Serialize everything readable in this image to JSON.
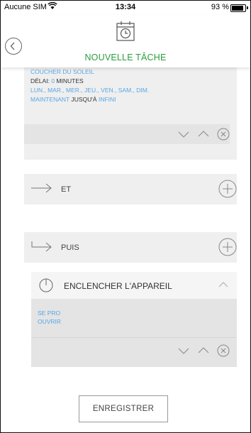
{
  "status_bar": {
    "carrier": "Aucune SIM",
    "time": "13:34",
    "battery": "93 %",
    "battery_level": 0.93
  },
  "header": {
    "title": "NOUVELLE TÂCHE",
    "icon": "calendar-clock-icon"
  },
  "condition": {
    "event": "COUCHER DU SOLEIL",
    "delay_label": "DÉLAI:",
    "delay_value": "0",
    "delay_unit": "MINUTES",
    "days": "LUN., MAR., MER., JEU., VEN., SAM., DIM.",
    "start": "MAINTENANT",
    "until": "JUSQU'À",
    "end": "INFINI"
  },
  "and_row": {
    "label": "ET"
  },
  "then_row": {
    "label": "PUIS"
  },
  "action": {
    "name": "ENCLENCHER L'APPAREIL",
    "option1": "SE PRO",
    "option2": "OUVRIR"
  },
  "save_button": {
    "label": "ENREGISTRER"
  },
  "colors": {
    "accent_green": "#2a9d3f",
    "link_blue": "#5aa6e4",
    "card_bg": "#efefef"
  }
}
